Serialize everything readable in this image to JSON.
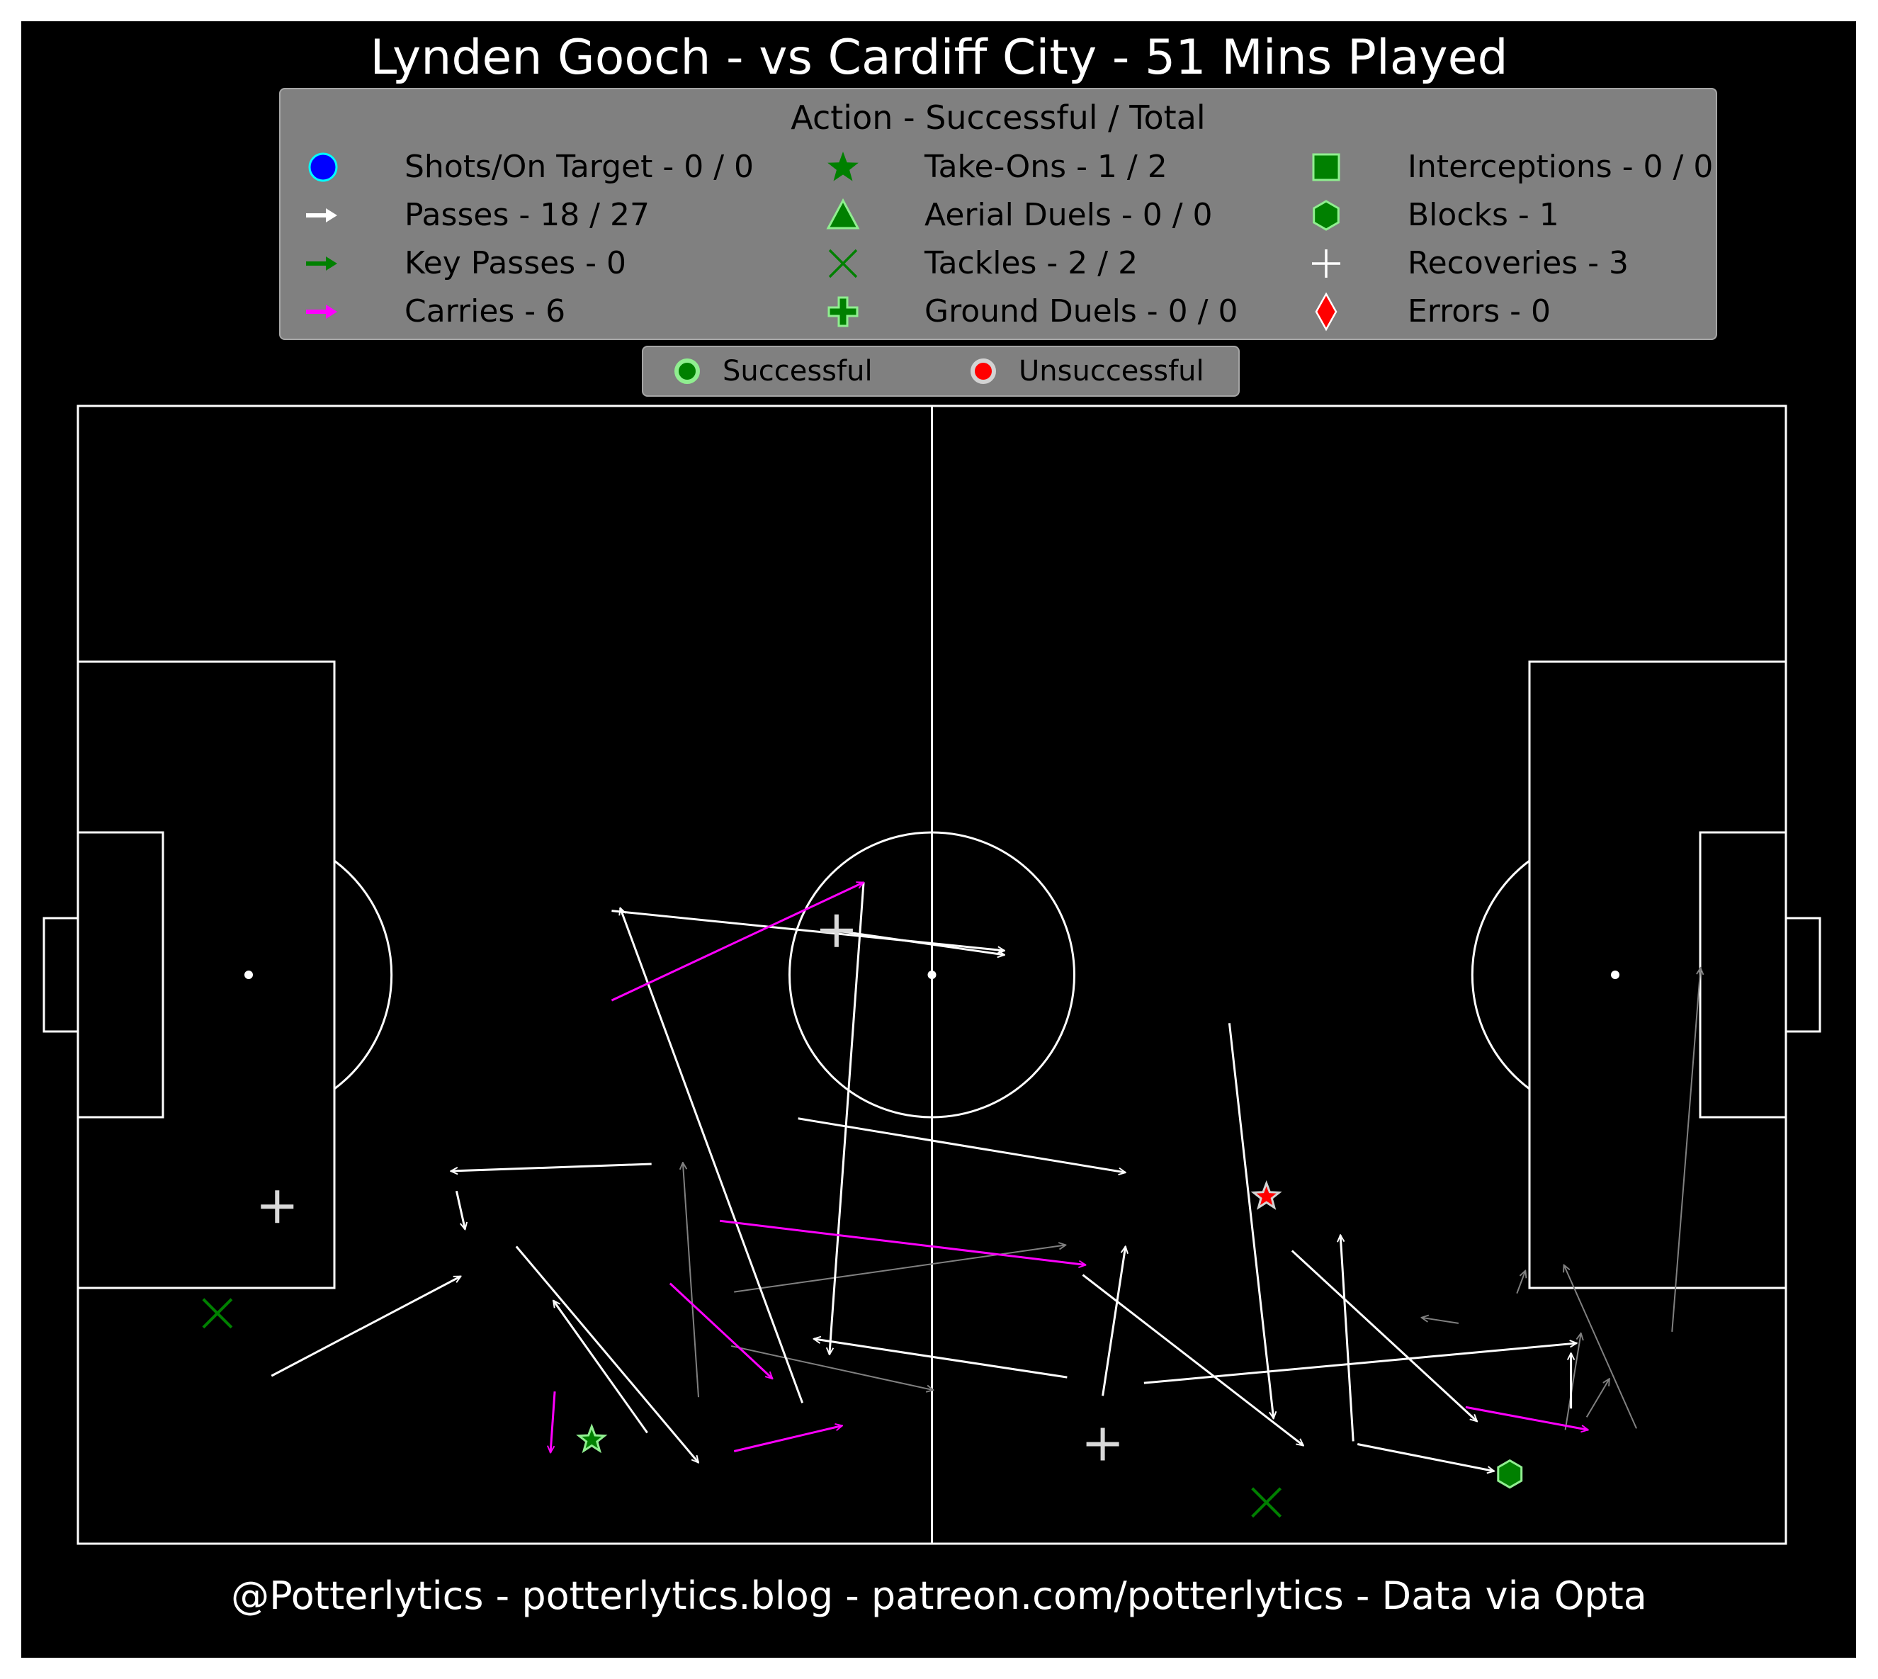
{
  "title": "Lynden Gooch - vs Cardiff City - 51 Mins Played",
  "footer": "@Potterlytics - potterlytics.blog - patreon.com/potterlytics - Data via Opta",
  "legend": {
    "title": "Action - Successful / Total",
    "items": [
      {
        "icon": "shot-circle-icon",
        "label": "Shots/On Target - 0 / 0",
        "color": "#0000ff",
        "edge": "#00ffff"
      },
      {
        "icon": "pass-arrow-icon",
        "label": "Passes - 18 / 27",
        "color": "#ffffff"
      },
      {
        "icon": "key-pass-arrow-icon",
        "label": "Key Passes - 0",
        "color": "#008000"
      },
      {
        "icon": "carry-arrow-icon",
        "label": "Carries - 6",
        "color": "#ff00ff"
      },
      {
        "icon": "take-on-star-icon",
        "label": "Take-Ons - 1 / 2",
        "color": "#008000"
      },
      {
        "icon": "aerial-triangle-icon",
        "label": "Aerial Duels - 0 / 0",
        "color": "#008000",
        "edge": "#90ee90"
      },
      {
        "icon": "tackle-x-icon",
        "label": "Tackles - 2 / 2",
        "color": "#008000"
      },
      {
        "icon": "ground-duel-plus-icon",
        "label": "Ground Duels - 0 / 0",
        "color": "#008000",
        "edge": "#90ee90"
      },
      {
        "icon": "interception-square-icon",
        "label": "Interceptions - 0 / 0",
        "color": "#008000",
        "edge": "#90ee90"
      },
      {
        "icon": "block-hexagon-icon",
        "label": "Blocks - 1",
        "color": "#008000",
        "edge": "#90ee90"
      },
      {
        "icon": "recovery-plus-icon",
        "label": "Recoveries - 3",
        "color": "#ffffff"
      },
      {
        "icon": "error-diamond-icon",
        "label": "Errors - 0",
        "color": "#ff0000",
        "edge": "#ffffff"
      }
    ]
  },
  "outcome_legend": {
    "successful": {
      "label": "Successful",
      "color": "#008000",
      "edge": "#90ee90"
    },
    "unsuccessful": {
      "label": "Unsuccessful",
      "color": "#ff0000",
      "edge": "#d3d3d3"
    }
  },
  "colors": {
    "background": "#000000",
    "pitch_lines": "#ffffff",
    "pass_success": "#ffffff",
    "pass_fail": "#808080",
    "carry": "#ff00ff",
    "defensive": "#008000",
    "recovery": "#d9d9d9",
    "unsuccessful": "#ff0000"
  },
  "chart_data": {
    "type": "scatter",
    "pitch": {
      "length": 120,
      "width": 80,
      "attacking_direction": "right"
    },
    "passes_successful": [
      [
        55.2,
        33.5,
        52.8,
        66.7
      ],
      [
        37.5,
        35.5,
        65.1,
        38.3
      ],
      [
        53.3,
        36.9,
        65.1,
        38.6
      ],
      [
        40.0,
        72.2,
        33.4,
        62.9
      ],
      [
        40.3,
        53.3,
        26.2,
        53.8
      ],
      [
        26.6,
        55.2,
        27.2,
        57.9
      ],
      [
        13.6,
        68.2,
        26.9,
        61.2
      ],
      [
        30.8,
        59.1,
        43.6,
        74.3
      ],
      [
        50.9,
        70.1,
        38.1,
        35.3
      ],
      [
        50.6,
        50.1,
        73.6,
        53.9
      ],
      [
        70.6,
        61.1,
        86.1,
        73.1
      ],
      [
        72.0,
        69.6,
        73.6,
        59.1
      ],
      [
        80.9,
        43.4,
        84.0,
        71.2
      ],
      [
        74.9,
        68.7,
        105.3,
        65.9
      ],
      [
        85.3,
        59.4,
        98.3,
        71.4
      ],
      [
        89.9,
        73.0,
        99.5,
        74.9
      ],
      [
        89.6,
        72.8,
        88.7,
        58.3
      ],
      [
        104.9,
        70.5,
        104.9,
        66.6
      ],
      [
        69.5,
        68.3,
        51.7,
        65.6
      ]
    ],
    "passes_unsuccessful": [
      [
        43.6,
        69.7,
        42.5,
        53.2
      ],
      [
        45.9,
        66.1,
        60.1,
        69.2
      ],
      [
        46.1,
        62.3,
        69.4,
        59.0
      ],
      [
        104.5,
        72.0,
        105.6,
        65.2
      ],
      [
        106.0,
        71.1,
        107.6,
        68.4
      ],
      [
        109.5,
        71.9,
        104.4,
        60.4
      ],
      [
        112.0,
        65.1,
        114.0,
        39.5
      ],
      [
        101.1,
        62.4,
        101.7,
        60.8
      ],
      [
        97.0,
        64.5,
        94.4,
        64.1
      ]
    ],
    "carries": [
      [
        37.5,
        41.8,
        55.2,
        33.5
      ],
      [
        41.6,
        61.7,
        48.8,
        68.4
      ],
      [
        33.5,
        69.3,
        33.2,
        73.6
      ],
      [
        46.1,
        73.5,
        53.7,
        71.7
      ],
      [
        45.1,
        57.3,
        70.8,
        60.4
      ],
      [
        97.5,
        70.4,
        106.1,
        72.0
      ]
    ],
    "take_ons": [
      {
        "x": 36.1,
        "y": 72.7,
        "outcome": "successful"
      },
      {
        "x": 83.5,
        "y": 55.6,
        "outcome": "unsuccessful"
      }
    ],
    "tackles": [
      [
        9.8,
        63.8
      ],
      [
        83.5,
        77.1
      ]
    ],
    "blocks": [
      [
        100.6,
        75.1
      ]
    ],
    "recoveries": [
      [
        53.3,
        36.9
      ],
      [
        14.0,
        56.3
      ],
      [
        72.0,
        73.0
      ]
    ],
    "shots": [],
    "key_passes": [],
    "aerial_duels": [],
    "ground_duels": [],
    "interceptions": [],
    "errors": []
  }
}
